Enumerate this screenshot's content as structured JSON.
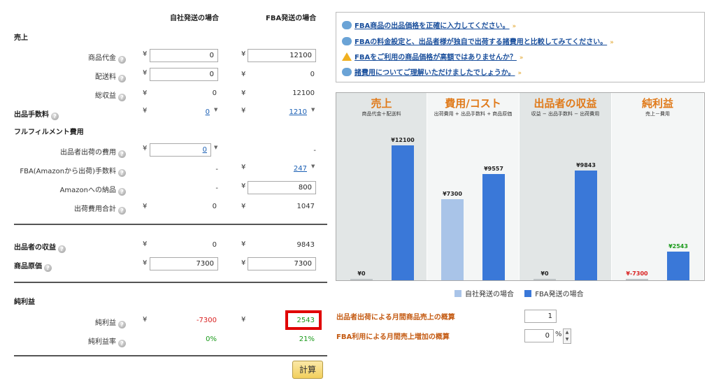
{
  "headers": {
    "self": "自社発送の場合",
    "fba": "FBA発送の場合"
  },
  "currency": "¥",
  "help_glyph": "?",
  "dropdown_glyph": "▼",
  "sections": {
    "sales": "売上",
    "fulfillment": "フルフィルメント費用",
    "profit": "純利益"
  },
  "rows": {
    "product_price": {
      "label": "商品代金",
      "self": "0",
      "fba": "12100"
    },
    "shipping_fee": {
      "label": "配送料",
      "self": "0",
      "fba": "0"
    },
    "total_revenue": {
      "label": "総収益",
      "self": "0",
      "fba": "12100"
    },
    "selling_fee": {
      "label": "出品手数料",
      "self": "0",
      "fba": "1210"
    },
    "seller_shipping_cost": {
      "label": "出品者出荷の費用",
      "self": "0",
      "fba": "-"
    },
    "fba_fee": {
      "label": "FBA(Amazonから出荷)手数料",
      "self": "-",
      "fba": "247"
    },
    "amazon_delivery": {
      "label": "Amazonへの納品",
      "self": "-",
      "fba": "800"
    },
    "shipping_total": {
      "label": "出荷費用合計",
      "self": "0",
      "fba": "1047"
    },
    "seller_proceeds": {
      "label": "出品者の収益",
      "self": "0",
      "fba": "9843"
    },
    "cost_of_goods": {
      "label": "商品原価",
      "self": "7300",
      "fba": "7300"
    },
    "net_profit": {
      "label": "純利益",
      "self": "-7300",
      "fba": "2543"
    },
    "net_margin": {
      "label": "純利益率",
      "self": "0%",
      "fba": "21%"
    }
  },
  "calculate_button": "計算",
  "tips": [
    {
      "icon": "speech-bubble-icon",
      "text": "FBA商品の出品価格を正確に入力してください。"
    },
    {
      "icon": "speech-bubble-icon",
      "text": "FBAの料金設定と、出品者様が独自で出荷する諸費用と比較してみてください。"
    },
    {
      "icon": "warning-icon",
      "text": "FBAをご利用の商品価格が高額ではありませんか？"
    },
    {
      "icon": "speech-bubble-icon",
      "text": "諸費用についてご理解いただけましたでしょうか。"
    }
  ],
  "tip_chevron": "»",
  "colors": {
    "self_bar": "#a9c4e8",
    "fba_bar": "#3a78d8",
    "accent": "#e07a1a",
    "highlight_border": "#e00000"
  },
  "chart_data": {
    "type": "bar",
    "panels": [
      {
        "title": "売上",
        "subtitle": "商品代金＋配送料",
        "self": 0,
        "fba": 12100,
        "self_label": "¥0",
        "fba_label": "¥12100"
      },
      {
        "title": "費用/コスト",
        "subtitle": "出荷費用 + 出品手数料 + 商品原価",
        "self": 7300,
        "fba": 9557,
        "self_label": "¥7300",
        "fba_label": "¥9557"
      },
      {
        "title": "出品者の収益",
        "subtitle": "収益 − 出品手数料 − 出荷費用",
        "self": 0,
        "fba": 9843,
        "self_label": "¥0",
        "fba_label": "¥9843"
      },
      {
        "title": "純利益",
        "subtitle": "売上－費用",
        "self": -7300,
        "fba": 2543,
        "self_label": "¥-7300",
        "fba_label": "¥2543"
      }
    ],
    "series": [
      {
        "name": "自社発送の場合",
        "color": "#a9c4e8"
      },
      {
        "name": "FBA発送の場合",
        "color": "#3a78d8"
      }
    ],
    "ylim": [
      0,
      12100
    ]
  },
  "estimates": {
    "monthly_sales_label": "出品者出荷による月間商品売上の概算",
    "monthly_sales_value": "1",
    "fba_increase_label": "FBA利用による月間売上増加の概算",
    "fba_increase_value": "0",
    "percent_sign": "%"
  }
}
